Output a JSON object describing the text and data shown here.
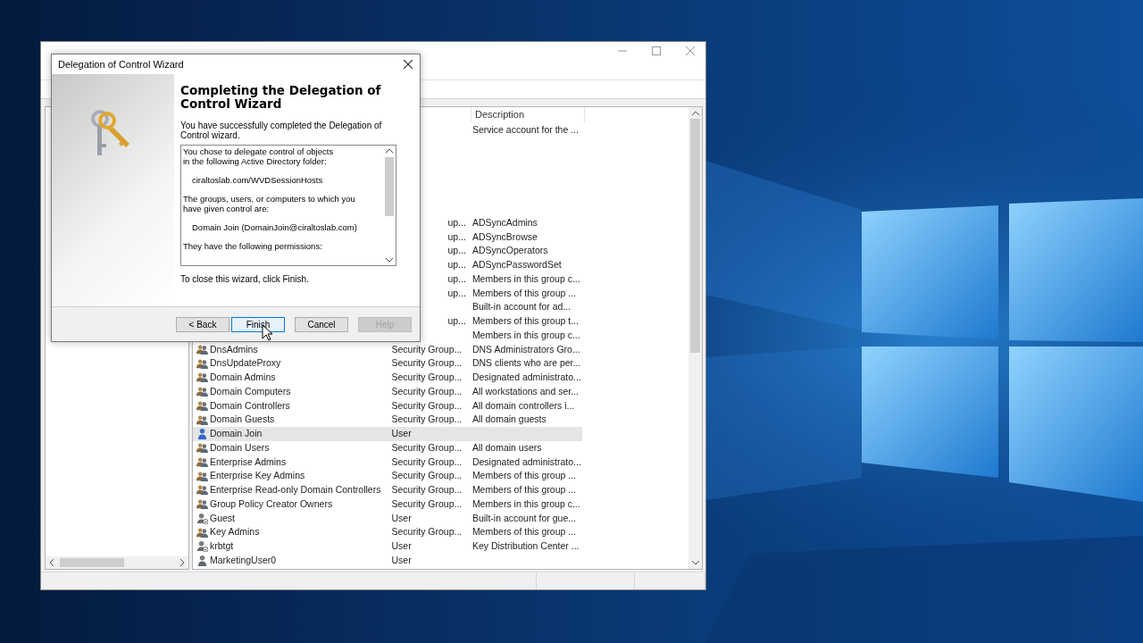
{
  "explorer_window": {
    "list": {
      "columns": [
        {
          "label": "Description"
        }
      ],
      "rows_top": [
        {
          "description": "Service account for the ..."
        }
      ],
      "rows": [
        {
          "type": "up...",
          "description": "ADSyncAdmins",
          "selected": false
        },
        {
          "type": "up...",
          "description": "ADSyncBrowse",
          "selected": false
        },
        {
          "type": "up...",
          "description": "ADSyncOperators",
          "selected": false
        },
        {
          "type": "up...",
          "description": "ADSyncPasswordSet",
          "selected": false
        },
        {
          "type": "up...",
          "description": "Members in this group c...",
          "selected": false
        },
        {
          "type": "up...",
          "description": "Members of this group ...",
          "selected": false
        },
        {
          "description": "Built-in account for ad...",
          "selected": false
        },
        {
          "type": "up...",
          "description": "Members of this group t...",
          "selected": false
        },
        {
          "description": "Members in this group c...",
          "selected": false
        },
        {
          "kind": "group",
          "name": "DnsAdmins",
          "type": "Security Group...",
          "description": "DNS Administrators Gro...",
          "selected": false
        },
        {
          "kind": "group",
          "name": "DnsUpdateProxy",
          "type": "Security Group...",
          "description": "DNS clients who are per...",
          "selected": false
        },
        {
          "kind": "group",
          "name": "Domain Admins",
          "type": "Security Group...",
          "description": "Designated administrato...",
          "selected": false
        },
        {
          "kind": "group",
          "name": "Domain Computers",
          "type": "Security Group...",
          "description": "All workstations and ser...",
          "selected": false
        },
        {
          "kind": "group",
          "name": "Domain Controllers",
          "type": "Security Group...",
          "description": "All domain controllers i...",
          "selected": false
        },
        {
          "kind": "group",
          "name": "Domain Guests",
          "type": "Security Group...",
          "description": "All domain guests",
          "selected": false
        },
        {
          "kind": "user",
          "name": "Domain Join",
          "type": "User",
          "selected": true
        },
        {
          "kind": "group",
          "name": "Domain Users",
          "type": "Security Group...",
          "description": "All domain users",
          "selected": false
        },
        {
          "kind": "group",
          "name": "Enterprise Admins",
          "type": "Security Group...",
          "description": "Designated administrato...",
          "selected": false
        },
        {
          "kind": "group",
          "name": "Enterprise Key Admins",
          "type": "Security Group...",
          "description": "Members of this group ...",
          "selected": false
        },
        {
          "kind": "group",
          "name": "Enterprise Read-only Domain Controllers",
          "type": "Security Group...",
          "description": "Members of this group ...",
          "selected": false
        },
        {
          "kind": "group",
          "name": "Group Policy Creator Owners",
          "type": "Security Group...",
          "description": "Members in this group c...",
          "selected": false
        },
        {
          "kind": "disabled-user",
          "name": "Guest",
          "type": "User",
          "description": "Built-in account for gue...",
          "selected": false
        },
        {
          "kind": "group",
          "name": "Key Admins",
          "type": "Security Group...",
          "description": "Members of this group ...",
          "selected": false
        },
        {
          "kind": "disabled-user",
          "name": "krbtgt",
          "type": "User",
          "description": "Key Distribution Center ...",
          "selected": false
        },
        {
          "kind": "user-plain",
          "name": "MarketingUser0",
          "type": "User",
          "selected": false
        }
      ]
    }
  },
  "dialog": {
    "title": "Delegation of Control Wizard",
    "heading": "Completing the Delegation of Control Wizard",
    "intro": "You have successfully completed the Delegation of Control wizard.",
    "summary": [
      {
        "kind": "text",
        "lines": [
          "You chose to delegate control of objects",
          "in the following Active Directory folder:"
        ]
      },
      {
        "kind": "value",
        "lines": [
          "ciraltoslab.com/WVDSessionHosts"
        ]
      },
      {
        "kind": "text",
        "lines": [
          "The groups, users, or computers to which you",
          "have given control are:"
        ]
      },
      {
        "kind": "value",
        "lines": [
          "Domain Join (DomainJoin@ciraltoslab.com)"
        ]
      },
      {
        "kind": "text",
        "lines": [
          "They have the following permissions:"
        ]
      }
    ],
    "footer": "To close this wizard, click Finish.",
    "buttons": [
      {
        "label": "< Back",
        "focused": false,
        "disabled": false
      },
      {
        "label": "Finish",
        "focused": true,
        "disabled": false
      },
      {
        "label": "Cancel",
        "focused": false,
        "disabled": false
      },
      {
        "label": "Help",
        "focused": false,
        "disabled": true
      }
    ]
  }
}
